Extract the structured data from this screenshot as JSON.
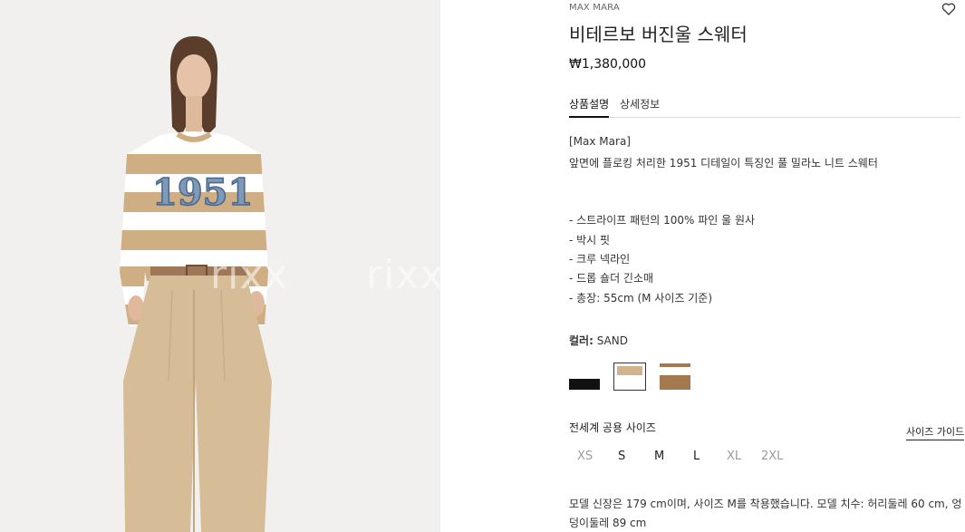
{
  "product": {
    "brand": "MAX MARA",
    "title": "비테르보 버진울 스웨터",
    "price": "₩1,380,000"
  },
  "image": {
    "watermark_1": "rixx",
    "watermark_2": "rixx"
  },
  "tabs": [
    {
      "label": "상품설명",
      "active": true
    },
    {
      "label": "상세정보",
      "active": false
    }
  ],
  "description": {
    "lines": [
      " [Max Mara]",
      "앞면에 플로킹 처리한 1951 디테일이 특징인 풀 밀라노 니트 스웨터",
      "- 스트라이프 패턴의 100% 파인 울 원사",
      "- 박시 핏",
      "- 크루 넥라인",
      "- 드롭 숄더 긴소매",
      "- 총장: 55cm (M 사이즈 기준)"
    ]
  },
  "color": {
    "label": "컬러:",
    "value": "SAND",
    "swatches": [
      {
        "name": "white-black",
        "top": "#ffffff",
        "bottom": "#111111",
        "selected": false
      },
      {
        "name": "sand",
        "top": "#ffffff",
        "bottom": "#d1b48e",
        "selected": true
      },
      {
        "name": "camel",
        "top": "#a4794f",
        "bottom": "#a4794f",
        "selected": false
      }
    ]
  },
  "sizes": {
    "heading": "전세계 공용 사이즈",
    "guide": "사이즈 가이드",
    "options": [
      {
        "label": "XS",
        "available": false
      },
      {
        "label": "S",
        "available": true
      },
      {
        "label": "M",
        "available": true
      },
      {
        "label": "L",
        "available": true
      },
      {
        "label": "XL",
        "available": false
      },
      {
        "label": "2XL",
        "available": false
      }
    ]
  },
  "model_info": {
    "line1": "모델 신장은 179 cm이며, 사이즈 M를 착용했습니다. 모델 치수: 허리둘레 60 cm, 엉",
    "line2": "덩이둘레 89 cm"
  },
  "icons": {
    "wishlist": "heart-outline-icon"
  }
}
